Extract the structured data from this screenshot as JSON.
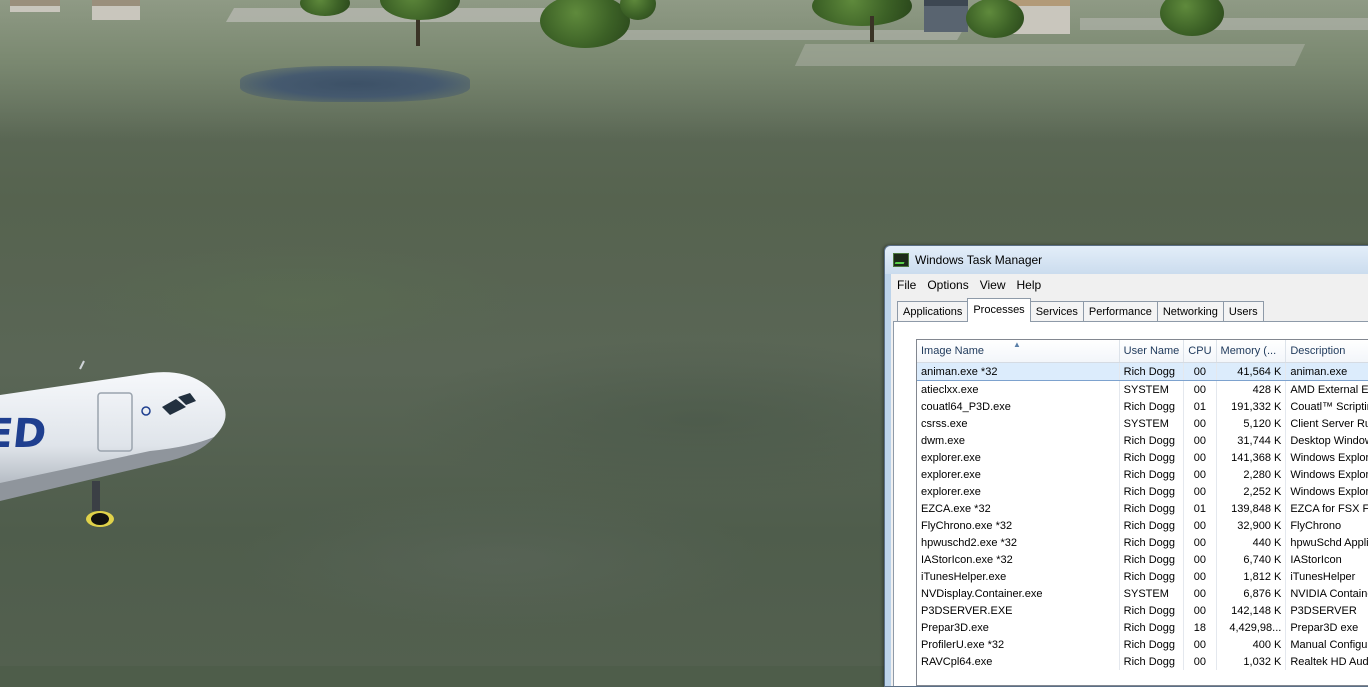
{
  "window": {
    "title": "Windows Task Manager",
    "menu": [
      "File",
      "Options",
      "View",
      "Help"
    ],
    "tabs": [
      "Applications",
      "Processes",
      "Services",
      "Performance",
      "Networking",
      "Users"
    ],
    "active_tab": "Processes"
  },
  "processes": {
    "columns": [
      "Image Name",
      "User Name",
      "CPU",
      "Memory (...",
      "Description"
    ],
    "sort_column": "Image Name",
    "rows": [
      {
        "image": "animan.exe *32",
        "user": "Rich Dogg",
        "cpu": "00",
        "memory": "41,564 K",
        "description": "animan.exe",
        "selected": true
      },
      {
        "image": "atieclxx.exe",
        "user": "SYSTEM",
        "cpu": "00",
        "memory": "428 K",
        "description": "AMD External Ev"
      },
      {
        "image": "couatl64_P3D.exe",
        "user": "Rich Dogg",
        "cpu": "01",
        "memory": "191,332 K",
        "description": "Couatl™ Scripting"
      },
      {
        "image": "csrss.exe",
        "user": "SYSTEM",
        "cpu": "00",
        "memory": "5,120 K",
        "description": "Client Server Run"
      },
      {
        "image": "dwm.exe",
        "user": "Rich Dogg",
        "cpu": "00",
        "memory": "31,744 K",
        "description": "Desktop Window"
      },
      {
        "image": "explorer.exe",
        "user": "Rich Dogg",
        "cpu": "00",
        "memory": "141,368 K",
        "description": "Windows Explore"
      },
      {
        "image": "explorer.exe",
        "user": "Rich Dogg",
        "cpu": "00",
        "memory": "2,280 K",
        "description": "Windows Explore"
      },
      {
        "image": "explorer.exe",
        "user": "Rich Dogg",
        "cpu": "00",
        "memory": "2,252 K",
        "description": "Windows Explore"
      },
      {
        "image": "EZCA.exe *32",
        "user": "Rich Dogg",
        "cpu": "01",
        "memory": "139,848 K",
        "description": "EZCA for FSX FS"
      },
      {
        "image": "FlyChrono.exe *32",
        "user": "Rich Dogg",
        "cpu": "00",
        "memory": "32,900 K",
        "description": "FlyChrono"
      },
      {
        "image": "hpwuschd2.exe *32",
        "user": "Rich Dogg",
        "cpu": "00",
        "memory": "440 K",
        "description": "hpwuSchd Applic"
      },
      {
        "image": "IAStorIcon.exe *32",
        "user": "Rich Dogg",
        "cpu": "00",
        "memory": "6,740 K",
        "description": "IAStorIcon"
      },
      {
        "image": "iTunesHelper.exe",
        "user": "Rich Dogg",
        "cpu": "00",
        "memory": "1,812 K",
        "description": "iTunesHelper"
      },
      {
        "image": "NVDisplay.Container.exe",
        "user": "SYSTEM",
        "cpu": "00",
        "memory": "6,876 K",
        "description": "NVIDIA Containe"
      },
      {
        "image": "P3DSERVER.EXE",
        "user": "Rich Dogg",
        "cpu": "00",
        "memory": "142,148 K",
        "description": "P3DSERVER"
      },
      {
        "image": "Prepar3D.exe",
        "user": "Rich Dogg",
        "cpu": "18",
        "memory": "4,429,98...",
        "description": "Prepar3D exe"
      },
      {
        "image": "ProfilerU.exe *32",
        "user": "Rich Dogg",
        "cpu": "00",
        "memory": "400 K",
        "description": "Manual Configu"
      },
      {
        "image": "RAVCpl64.exe",
        "user": "Rich Dogg",
        "cpu": "00",
        "memory": "1,032 K",
        "description": "Realtek HD Audi"
      }
    ]
  },
  "aircraft": {
    "livery_text": "ED",
    "fuselage_color": "#eef1f5",
    "livery_color": "#1f3f8f"
  },
  "colors": {
    "selection": "#dcecfc",
    "header_text": "#1e395b",
    "title_bar": "#cbdcee"
  }
}
